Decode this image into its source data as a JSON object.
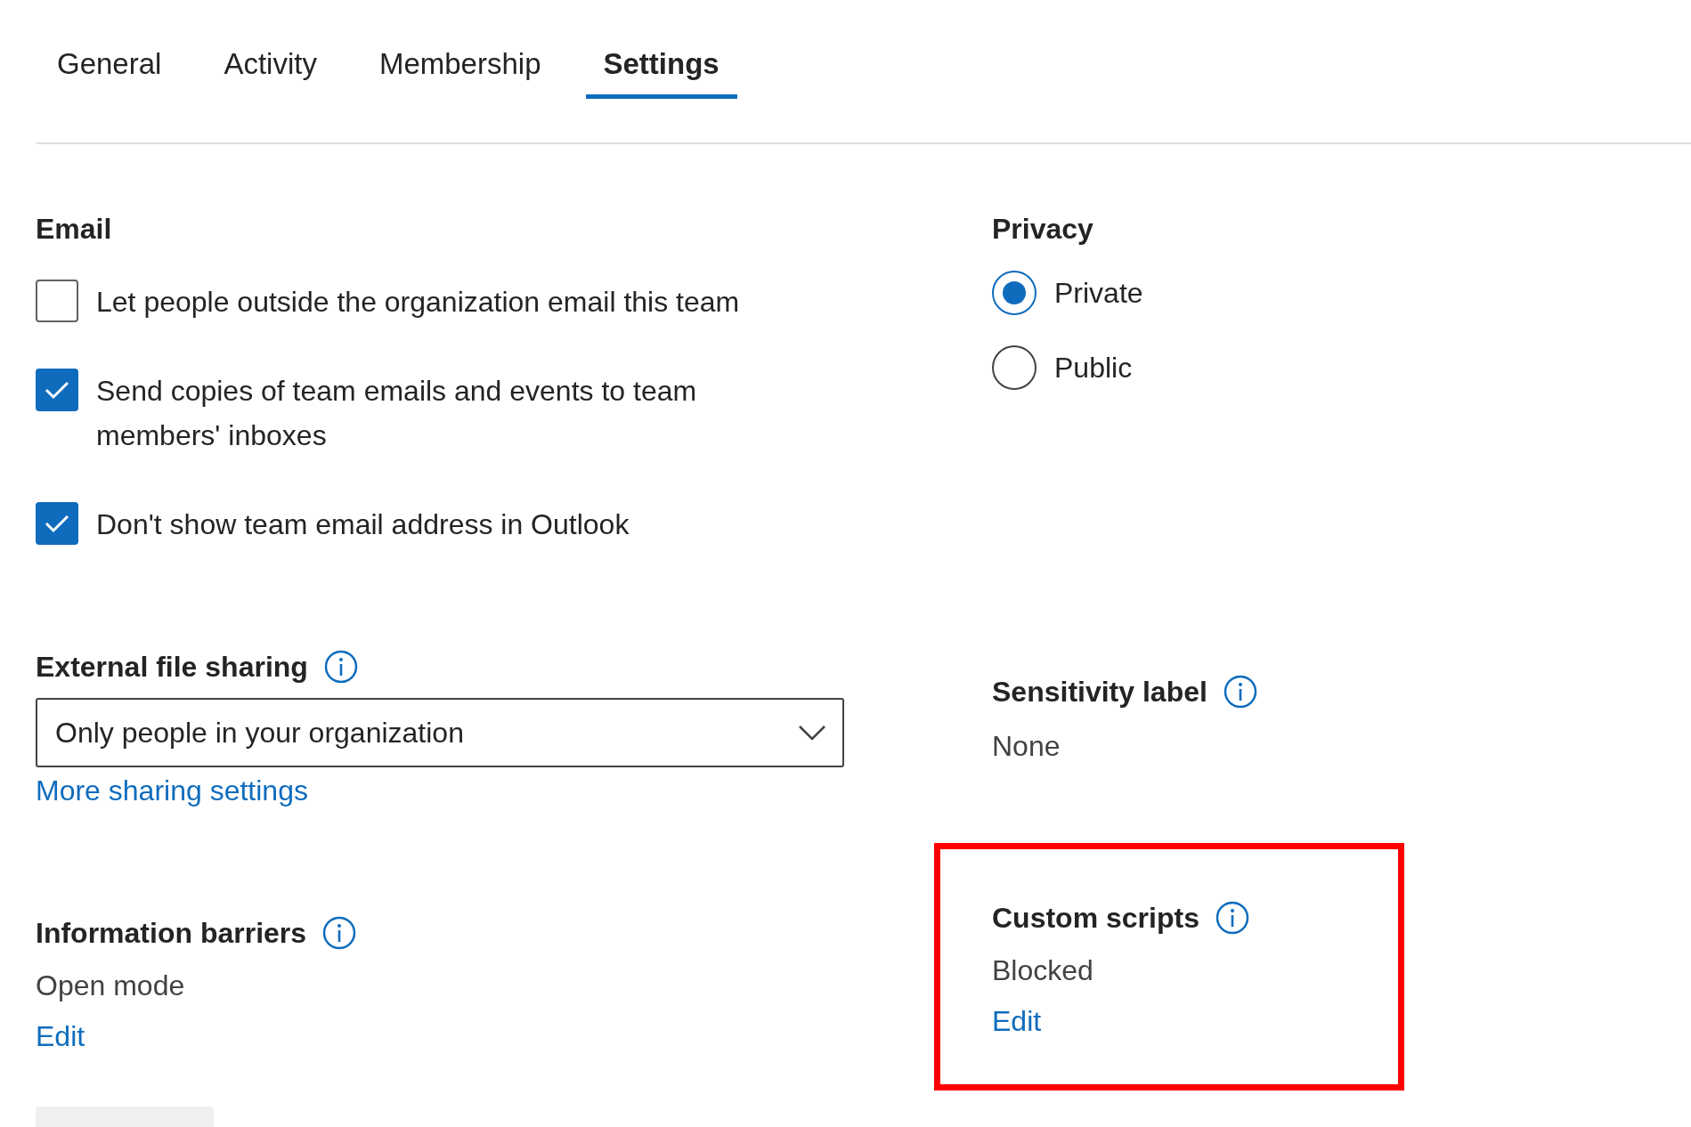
{
  "tabs": [
    {
      "label": "General",
      "selected": false
    },
    {
      "label": "Activity",
      "selected": false
    },
    {
      "label": "Membership",
      "selected": false
    },
    {
      "label": "Settings",
      "selected": true
    }
  ],
  "email": {
    "heading": "Email",
    "options": [
      {
        "label": "Let people outside the organization email this team",
        "checked": false
      },
      {
        "label": "Send copies of team emails and events to team members' inboxes",
        "checked": true
      },
      {
        "label": "Don't show team email address in Outlook",
        "checked": true
      }
    ]
  },
  "privacy": {
    "heading": "Privacy",
    "options": [
      {
        "label": "Private",
        "selected": true
      },
      {
        "label": "Public",
        "selected": false
      }
    ]
  },
  "external_file_sharing": {
    "heading": "External file sharing",
    "dropdown": {
      "value": "Only people in your organization"
    },
    "link": "More sharing settings"
  },
  "sensitivity_label": {
    "heading": "Sensitivity label",
    "value": "None"
  },
  "information_barriers": {
    "heading": "Information barriers",
    "value": "Open mode",
    "link": "Edit"
  },
  "custom_scripts": {
    "heading": "Custom scripts",
    "value": "Blocked",
    "link": "Edit",
    "highlighted": true
  }
}
